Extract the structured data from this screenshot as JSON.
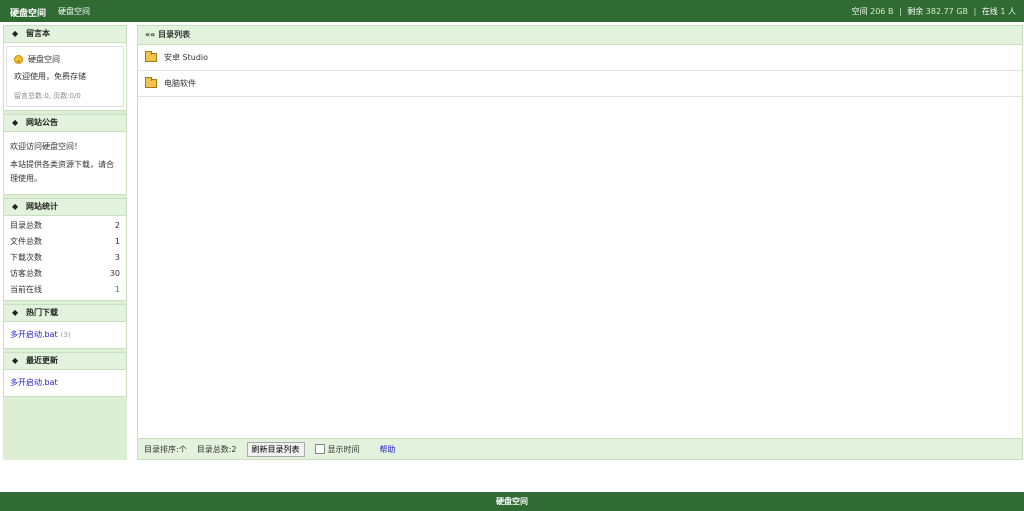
{
  "header": {
    "brand": "硬盘空间",
    "brand_link": "硬盘空间",
    "space_label": "空间",
    "space_value": "206 B",
    "remain_label": "剩余",
    "remain_value": "382.77 GB",
    "online_label": "在线",
    "online_value": "1",
    "online_unit": "人"
  },
  "sidebar": {
    "guestbook": {
      "title": "留言本",
      "name": "硬盘空间",
      "message": "欢迎使用，免费存储",
      "stats": "留言总数:0, 页数:0/0"
    },
    "notice": {
      "title": "网站公告",
      "line1": "欢迎访问硬盘空间！",
      "line2": "本站提供各类资源下载，请合理使用。"
    },
    "site_stats": {
      "title": "网站统计",
      "rows": [
        {
          "label": "目录总数",
          "value": "2"
        },
        {
          "label": "文件总数",
          "value": "1"
        },
        {
          "label": "下载次数",
          "value": "3"
        },
        {
          "label": "访客总数",
          "value": "30"
        },
        {
          "label": "当前在线",
          "value": "1"
        }
      ]
    },
    "hot_downloads": {
      "title": "热门下载",
      "item": "多开启动.bat",
      "count": "(3)"
    },
    "recent_updates": {
      "title": "最近更新",
      "item": "多开启动.bat"
    }
  },
  "main": {
    "title": "«« 目录列表",
    "dirs": [
      {
        "name": "安卓 Studio"
      },
      {
        "name": "电脑软件"
      }
    ],
    "footer": {
      "sort_label": "目录排序:个",
      "count_label": "目录总数:2",
      "refresh_button": "刷新目录列表",
      "show_time_label": "显示时间",
      "help_link": "帮助"
    }
  },
  "bottom": {
    "text": "硬盘空间"
  },
  "colors": {
    "header_bg": "#2f6b33",
    "panel_header_bg": "#e3f2dd",
    "sidebar_bg": "#dcefd5",
    "link": "#2424c8",
    "online_green": "#21a021"
  }
}
